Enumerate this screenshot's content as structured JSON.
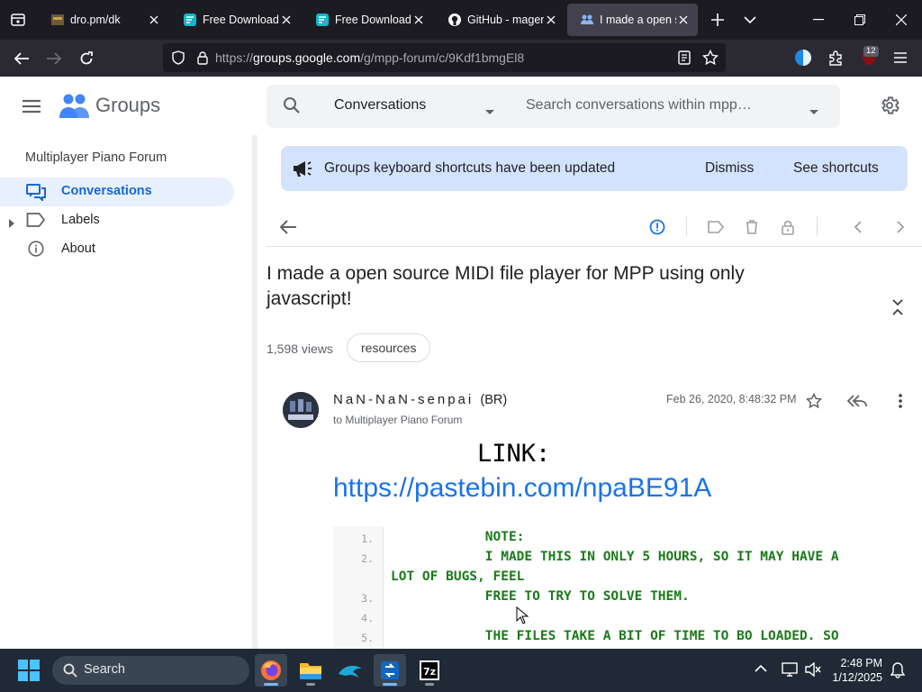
{
  "browser": {
    "tabs": [
      {
        "title": "dro.pm/dk",
        "active": false
      },
      {
        "title": "Free Download | Ma",
        "active": false
      },
      {
        "title": "Free Download | Ma",
        "active": false
      },
      {
        "title": "GitHub - magenta/",
        "active": false
      },
      {
        "title": "I made a open so",
        "active": true
      }
    ],
    "url_prefix": "https://",
    "url_host": "groups.google.com",
    "url_path": "/g/mpp-forum/c/9Kdf1bmgEl8",
    "extension_badge": "12"
  },
  "groups": {
    "brand": "Groups",
    "search_scope": "Conversations",
    "search_placeholder": "Search conversations within mpp…"
  },
  "sidebar": {
    "forum_name": "Multiplayer Piano Forum",
    "items": [
      {
        "label": "Conversations",
        "active": true
      },
      {
        "label": "Labels",
        "active": false
      },
      {
        "label": "About",
        "active": false
      }
    ]
  },
  "banner": {
    "text": "Groups keyboard shortcuts have been updated",
    "dismiss": "Dismiss",
    "see_shortcuts": "See shortcuts"
  },
  "thread": {
    "title": "I made a open source MIDI file player for MPP using only javascript!",
    "views": "1,598 views",
    "tag": "resources"
  },
  "post": {
    "author": "NaN-NaN-senpai",
    "country": "(BR)",
    "to_line": "to Multiplayer Piano Forum",
    "date": "Feb 26, 2020, 8:48:32 PM",
    "link_label": "LINK:",
    "link_url": "https://pastebin.com/npaBE91A",
    "code_lines": [
      {
        "num": "1.",
        "text": "            NOTE:"
      },
      {
        "num": "2.",
        "text": "            I MADE THIS IN ONLY 5 HOURS, SO IT MAY HAVE A"
      },
      {
        "num": "",
        "text": "LOT OF BUGS, FEEL"
      },
      {
        "num": "3.",
        "text": "            FREE TO TRY TO SOLVE THEM."
      },
      {
        "num": "4.",
        "text": ""
      },
      {
        "num": "5.",
        "text": "            THE FILES TAKE A BIT OF TIME TO BO LOADED. SO"
      }
    ]
  },
  "taskbar": {
    "search_label": "Search",
    "time": "2:48 PM",
    "date": "1/12/2025",
    "accent": "#76b9ed"
  }
}
